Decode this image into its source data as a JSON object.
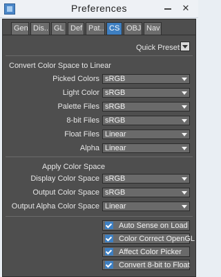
{
  "window": {
    "title": "Preferences",
    "close_label": "✕"
  },
  "tabs": [
    {
      "label": "Gen",
      "active": false
    },
    {
      "label": "Dis...",
      "active": false
    },
    {
      "label": "GL",
      "active": false
    },
    {
      "label": "Def",
      "active": false
    },
    {
      "label": "Pat...",
      "active": false
    },
    {
      "label": "CS",
      "active": true
    },
    {
      "label": "OBJ",
      "active": false
    },
    {
      "label": "Nav",
      "active": false
    }
  ],
  "quick_presets": {
    "label": "Quick Presets"
  },
  "convert_section": {
    "title": "Convert Color Space to Linear",
    "rows": [
      {
        "label": "Picked Colors",
        "value": "sRGB"
      },
      {
        "label": "Light Color",
        "value": "sRGB"
      },
      {
        "label": "Palette Files",
        "value": "sRGB"
      },
      {
        "label": "8-bit Files",
        "value": "sRGB"
      },
      {
        "label": "Float Files",
        "value": "Linear"
      },
      {
        "label": "Alpha",
        "value": "Linear"
      }
    ]
  },
  "apply_section": {
    "title": "Apply Color Space",
    "rows": [
      {
        "label": "Display Color Space",
        "value": "sRGB"
      },
      {
        "label": "Output Color Space",
        "value": "sRGB"
      },
      {
        "label": "Output Alpha Color Space",
        "value": "Linear"
      }
    ]
  },
  "options": [
    {
      "label": "Auto Sense on Load",
      "checked": true
    },
    {
      "label": "Color Correct OpenGL",
      "checked": true
    },
    {
      "label": "Affect Color Picker",
      "checked": true
    },
    {
      "label": "Convert 8-bit to Float",
      "checked": true
    }
  ]
}
